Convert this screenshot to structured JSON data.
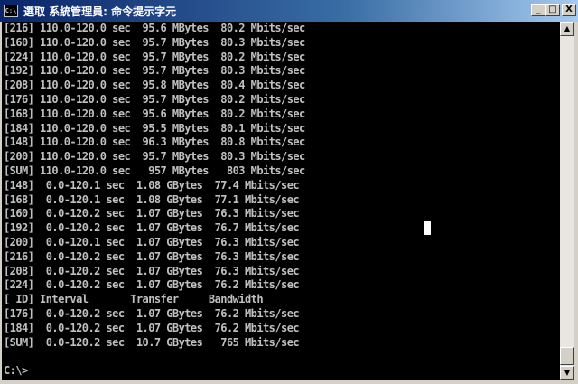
{
  "window": {
    "title": "選取 系統管理員: 命令提示字元",
    "icon_label": "C:\\",
    "buttons": {
      "minimize": "_",
      "maximize": "□",
      "close": "X"
    }
  },
  "console": {
    "lines": [
      "[216] 110.0-120.0 sec  95.6 MBytes  80.2 Mbits/sec",
      "[160] 110.0-120.0 sec  95.7 MBytes  80.3 Mbits/sec",
      "[224] 110.0-120.0 sec  95.7 MBytes  80.2 Mbits/sec",
      "[192] 110.0-120.0 sec  95.7 MBytes  80.3 Mbits/sec",
      "[208] 110.0-120.0 sec  95.8 MBytes  80.4 Mbits/sec",
      "[176] 110.0-120.0 sec  95.7 MBytes  80.2 Mbits/sec",
      "[168] 110.0-120.0 sec  95.6 MBytes  80.2 Mbits/sec",
      "[184] 110.0-120.0 sec  95.5 MBytes  80.1 Mbits/sec",
      "[148] 110.0-120.0 sec  96.3 MBytes  80.8 Mbits/sec",
      "[200] 110.0-120.0 sec  95.7 MBytes  80.3 Mbits/sec",
      "[SUM] 110.0-120.0 sec   957 MBytes   803 Mbits/sec",
      "[148]  0.0-120.1 sec  1.08 GBytes  77.4 Mbits/sec",
      "[168]  0.0-120.1 sec  1.08 GBytes  77.1 Mbits/sec",
      "[160]  0.0-120.2 sec  1.07 GBytes  76.3 Mbits/sec",
      "[192]  0.0-120.2 sec  1.07 GBytes  76.7 Mbits/sec",
      "[200]  0.0-120.1 sec  1.07 GBytes  76.3 Mbits/sec",
      "[216]  0.0-120.2 sec  1.07 GBytes  76.3 Mbits/sec",
      "[208]  0.0-120.2 sec  1.07 GBytes  76.3 Mbits/sec",
      "[224]  0.0-120.2 sec  1.07 GBytes  76.2 Mbits/sec",
      "[ ID] Interval       Transfer     Bandwidth",
      "[176]  0.0-120.2 sec  1.07 GBytes  76.2 Mbits/sec",
      "[184]  0.0-120.2 sec  1.07 GBytes  76.2 Mbits/sec",
      "[SUM]  0.0-120.2 sec  10.7 GBytes   765 Mbits/sec"
    ],
    "prompt": "C:\\>"
  },
  "scrollbar": {
    "up_arrow": "▲",
    "down_arrow": "▼"
  },
  "colors": {
    "console_bg": "#000000",
    "console_text": "#c0c0c0",
    "titlebar_start": "#0a246a",
    "titlebar_end": "#a6caf0",
    "frame": "#d4d0c8"
  }
}
